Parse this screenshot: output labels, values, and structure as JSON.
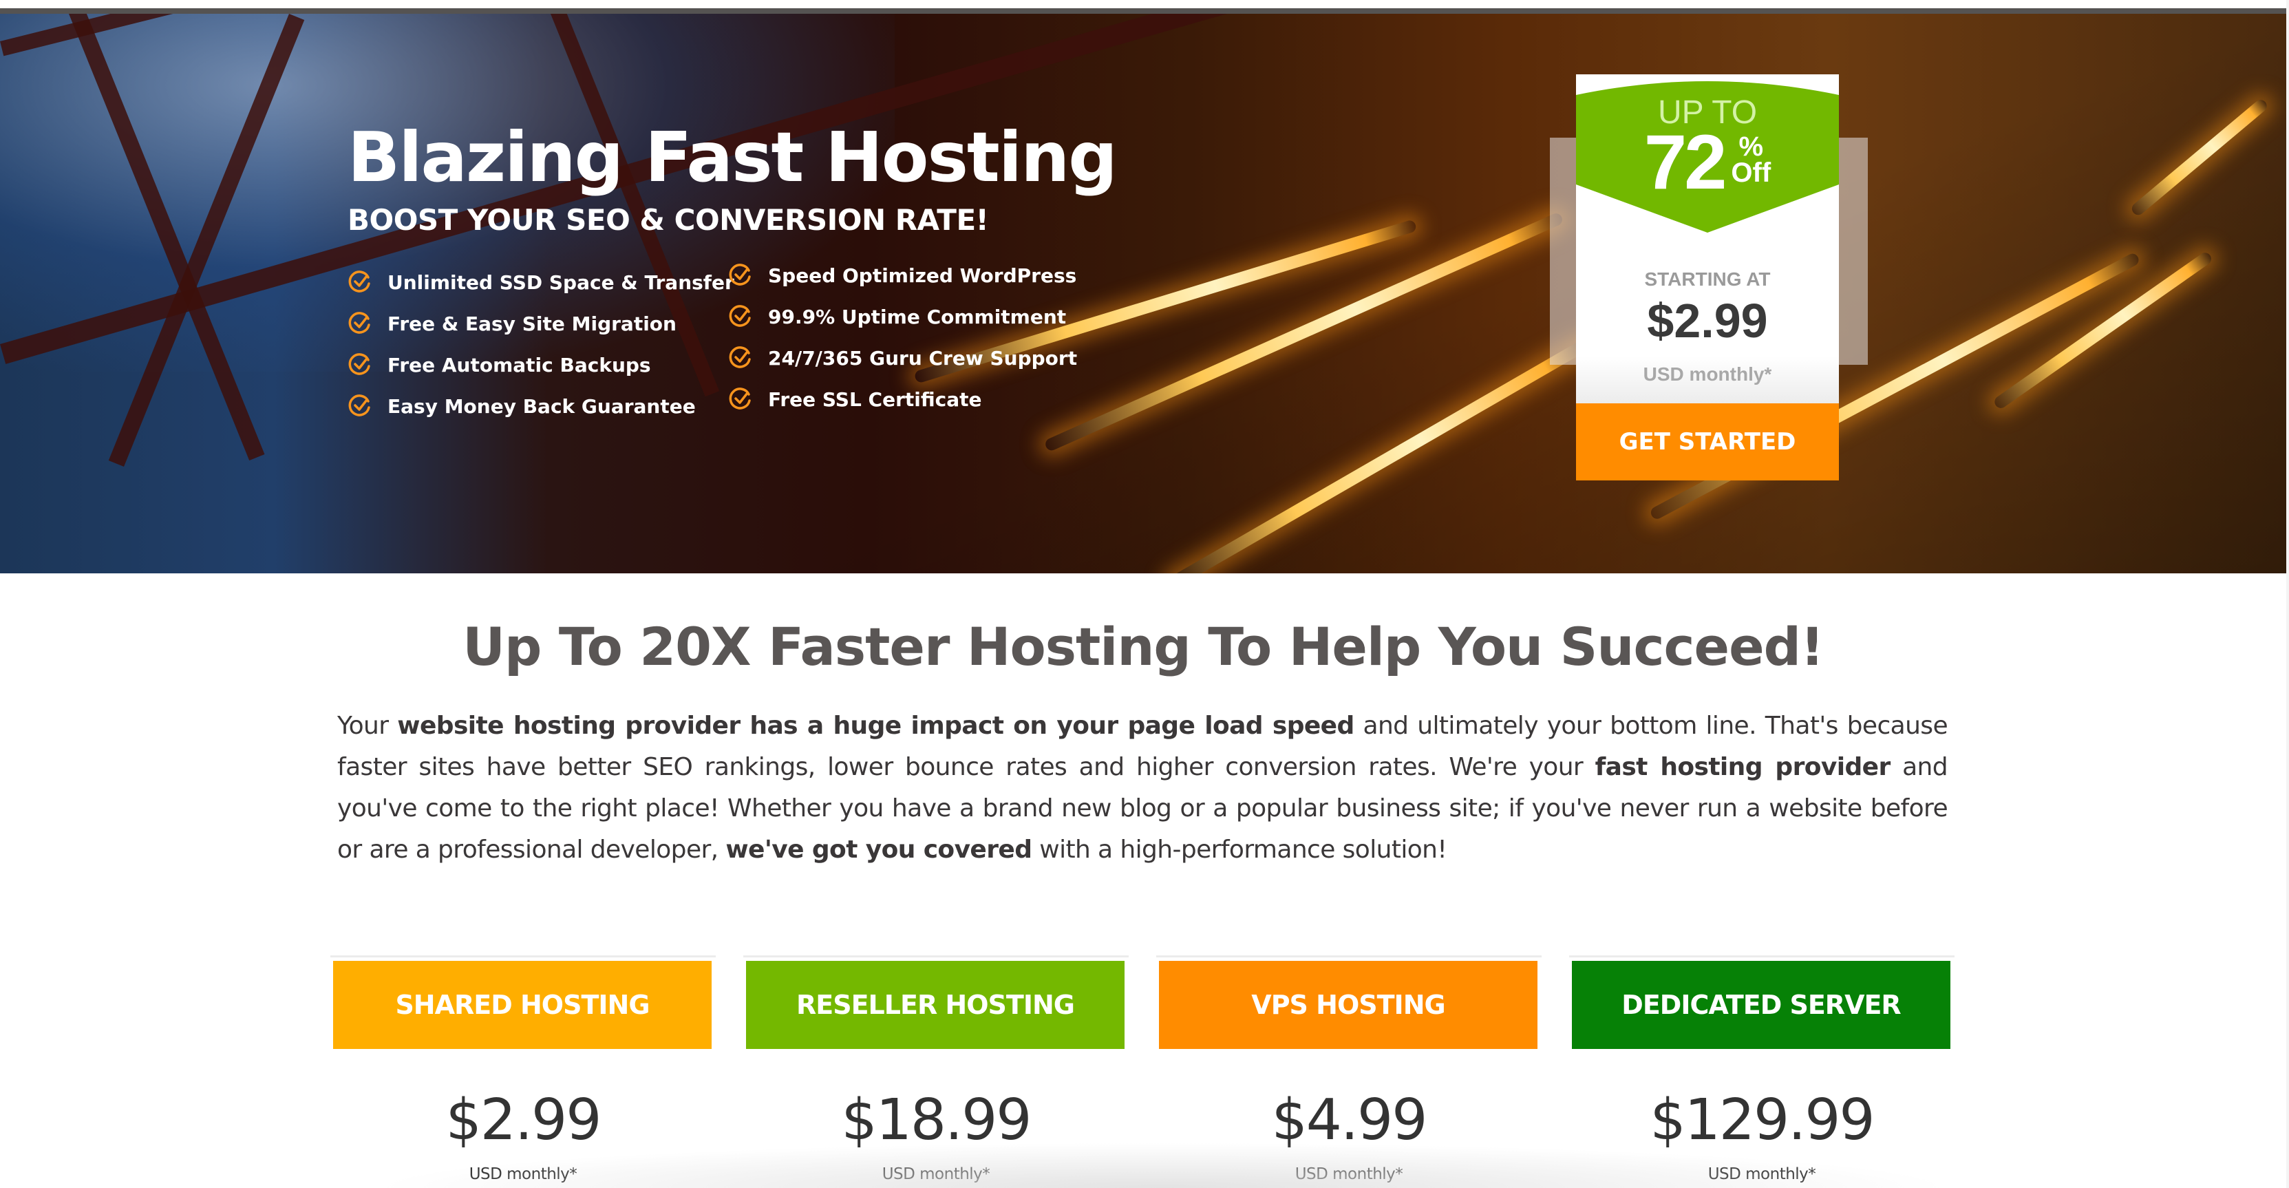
{
  "hero": {
    "title": "Blazing Fast Hosting",
    "subtitle": "BOOST YOUR SEO & CONVERSION RATE!",
    "features_left": [
      "Unlimited SSD Space & Transfer",
      "Free & Easy Site Migration",
      "Free Automatic Backups",
      "Easy Money Back Guarantee"
    ],
    "features_right": [
      "Speed Optimized WordPress",
      "99.9% Uptime Commitment",
      "24/7/365 Guru Crew Support",
      "Free SSL Certificate"
    ],
    "feature_icon": "circle-check-icon",
    "icon_color": "#f7941d"
  },
  "promo": {
    "up_to": "UP TO",
    "discount": "72",
    "percent": "%",
    "off": "Off",
    "starting_at": "STARTING AT",
    "price": "$2.99",
    "period": "USD monthly*",
    "cta": "GET STARTED",
    "colors": {
      "green": "#72b800",
      "button": "#ff8c00"
    }
  },
  "section": {
    "title": "Up To 20X Faster Hosting To Help You Succeed!",
    "intro": [
      {
        "text": "Your ",
        "bold": false
      },
      {
        "text": "website hosting provider has a huge impact on your page load speed",
        "bold": true
      },
      {
        "text": " and ultimately your bottom line. That's because faster sites have better SEO rankings, lower bounce rates and higher conversion rates. We're your ",
        "bold": false
      },
      {
        "text": "fast hosting provider",
        "bold": true
      },
      {
        "text": " and you've come to the right place! Whether you have a brand new blog or a popular business site; if you've never run a website before or are a professional developer, ",
        "bold": false
      },
      {
        "text": "we've got you covered",
        "bold": true
      },
      {
        "text": " with a high-performance solution!",
        "bold": false
      }
    ]
  },
  "plans": [
    {
      "name": "SHARED HOSTING",
      "price": "$2.99",
      "period": "USD monthly*",
      "color": "#ffae00"
    },
    {
      "name": "RESELLER HOSTING",
      "price": "$18.99",
      "period": "USD monthly*",
      "color": "#74b800"
    },
    {
      "name": "VPS HOSTING",
      "price": "$4.99",
      "period": "USD monthly*",
      "color": "#ff8c00"
    },
    {
      "name": "DEDICATED SERVER",
      "price": "$129.99",
      "period": "USD monthly*",
      "color": "#068106"
    }
  ]
}
